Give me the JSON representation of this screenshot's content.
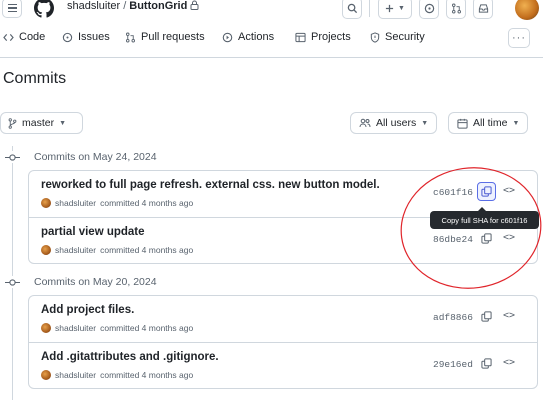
{
  "header": {
    "owner": "shadsluiter",
    "separator": "/",
    "repo": "ButtonGrid"
  },
  "tabs": [
    {
      "label": "Code",
      "icon": "code-icon"
    },
    {
      "label": "Issues",
      "icon": "issue-icon"
    },
    {
      "label": "Pull requests",
      "icon": "pull-request-icon"
    },
    {
      "label": "Actions",
      "icon": "actions-icon"
    },
    {
      "label": "Projects",
      "icon": "table-icon"
    },
    {
      "label": "Security",
      "icon": "shield-icon"
    }
  ],
  "page": {
    "title": "Commits"
  },
  "filters": {
    "branch": "master",
    "users": "All users",
    "time": "All time"
  },
  "groups": [
    {
      "date_label": "Commits on May 24, 2024",
      "commits": [
        {
          "message": "reworked to full page refresh. external css. new button model.",
          "author": "shadsluiter",
          "when": "committed 4 months ago",
          "sha": "c601f16"
        },
        {
          "message": "partial view update",
          "author": "shadsluiter",
          "when": "committed 4 months ago",
          "sha": "86dbe24"
        }
      ]
    },
    {
      "date_label": "Commits on May 20, 2024",
      "commits": [
        {
          "message": "Add project files.",
          "author": "shadsluiter",
          "when": "committed 4 months ago",
          "sha": "adf8866"
        },
        {
          "message": "Add .gitattributes and .gitignore.",
          "author": "shadsluiter",
          "when": "committed 4 months ago",
          "sha": "29e16ed"
        }
      ]
    }
  ],
  "tooltip": {
    "text": "Copy full SHA for c601f16"
  },
  "colors": {
    "accent": "#5a6ee6",
    "annotation": "#e0252b",
    "border": "#d0d7de",
    "muted": "#59636e"
  }
}
